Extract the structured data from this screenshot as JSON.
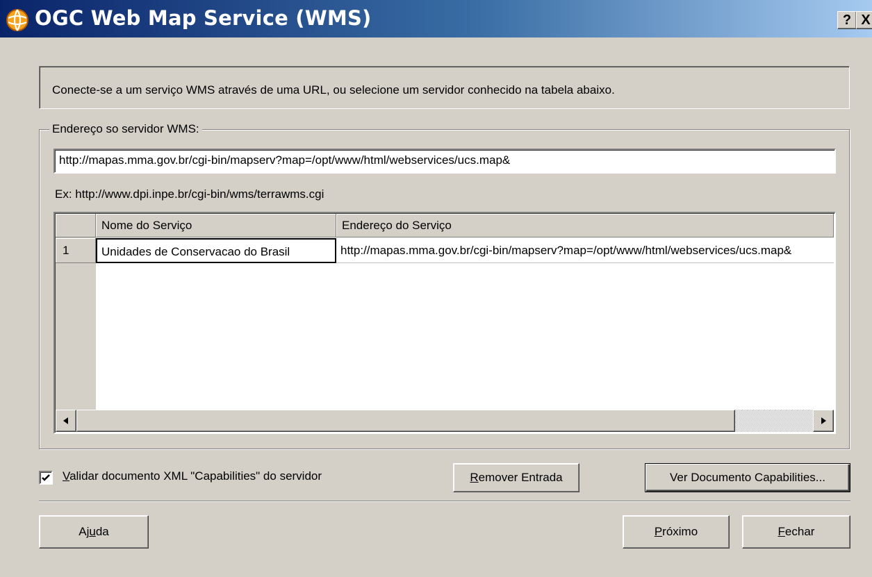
{
  "window": {
    "title": "OGC Web Map Service (WMS)",
    "help_button": "?",
    "close_button": "X",
    "app_icon": "globe-icon"
  },
  "info": {
    "text": "Conecte-se a um serviço WMS através de uma URL, ou selecione um servidor conhecido na tabela abaixo."
  },
  "server_group": {
    "legend": "Endereço so servidor WMS:",
    "url_value": "http://mapas.mma.gov.br/cgi-bin/mapserv?map=/opt/www/html/webservices/ucs.map&",
    "example": "Ex: http://www.dpi.inpe.br/cgi-bin/wms/terrawms.cgi"
  },
  "table": {
    "columns": [
      "Nome do Serviço",
      "Endereço do Serviço"
    ],
    "rows": [
      {
        "num": "1",
        "name": "Unidades de Conservacao do Brasil",
        "address": "http://mapas.mma.gov.br/cgi-bin/mapserv?map=/opt/www/html/webservices/ucs.map&"
      }
    ]
  },
  "options": {
    "validate_checked": true,
    "validate_label": "Validar documento XML \"Capabilities\" do servidor"
  },
  "buttons": {
    "remove": "Remover Entrada",
    "view_capabilities": "Ver Documento Capabilities...",
    "help": "Ajuda",
    "next": "Próximo",
    "close": "Fechar"
  }
}
